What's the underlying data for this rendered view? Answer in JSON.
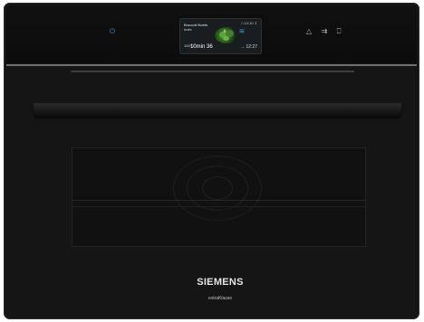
{
  "display": {
    "program_title": "Broccoli florets",
    "program_subtitle": "Indiv.",
    "status": "□ 12:10 ↧",
    "temperature": "100°C",
    "duration": "10min 36",
    "end_time": "→ 12:27"
  },
  "controls": {
    "power_icon": "⏻",
    "pause_icon": "⏸",
    "wifi_icon": "≋",
    "light_icon": "△",
    "child_lock_icon": "⇉",
    "water_tank_icon": "⎕"
  },
  "branding": {
    "brand": "SIEMENS",
    "line": "extraKlasse"
  },
  "colors": {
    "body": "#151515",
    "accent_blue": "#3c8fd8"
  }
}
